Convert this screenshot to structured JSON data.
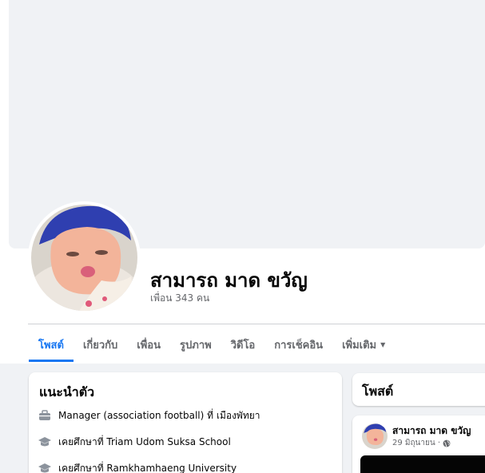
{
  "profile": {
    "name": "สามารถ มาด ขวัญ",
    "friends": "เพื่อน 343 คน"
  },
  "tabs": [
    {
      "label": "โพสต์",
      "active": true
    },
    {
      "label": "เกี่ยวกับ"
    },
    {
      "label": "เพื่อน"
    },
    {
      "label": "รูปภาพ"
    },
    {
      "label": "วิดีโอ"
    },
    {
      "label": "การเช็คอิน"
    },
    {
      "label": "เพิ่มเติม",
      "icon": "caret-down-icon"
    }
  ],
  "intro": {
    "title": "แนะนำตัว",
    "items": [
      {
        "icon": "briefcase-icon",
        "text": "Manager (association football) ที่ เมืองพัทยา"
      },
      {
        "icon": "graduation-cap-icon",
        "text": "เคยศึกษาที่ Triam Udom Suksa School"
      },
      {
        "icon": "graduation-cap-icon",
        "text": "เคยศึกษาที่ Ramkhamhaeng University"
      }
    ]
  },
  "posts": {
    "title": "โพสต์",
    "first_post": {
      "author": "สามารถ มาด ขวัญ",
      "date": "29 มิถุนายน ·",
      "privacy_icon": "globe-icon"
    }
  },
  "colors": {
    "accent": "#1877f2",
    "page_bg": "#f0f2f5",
    "secondary_text": "#65676b",
    "card_bg": "#ffffff"
  }
}
